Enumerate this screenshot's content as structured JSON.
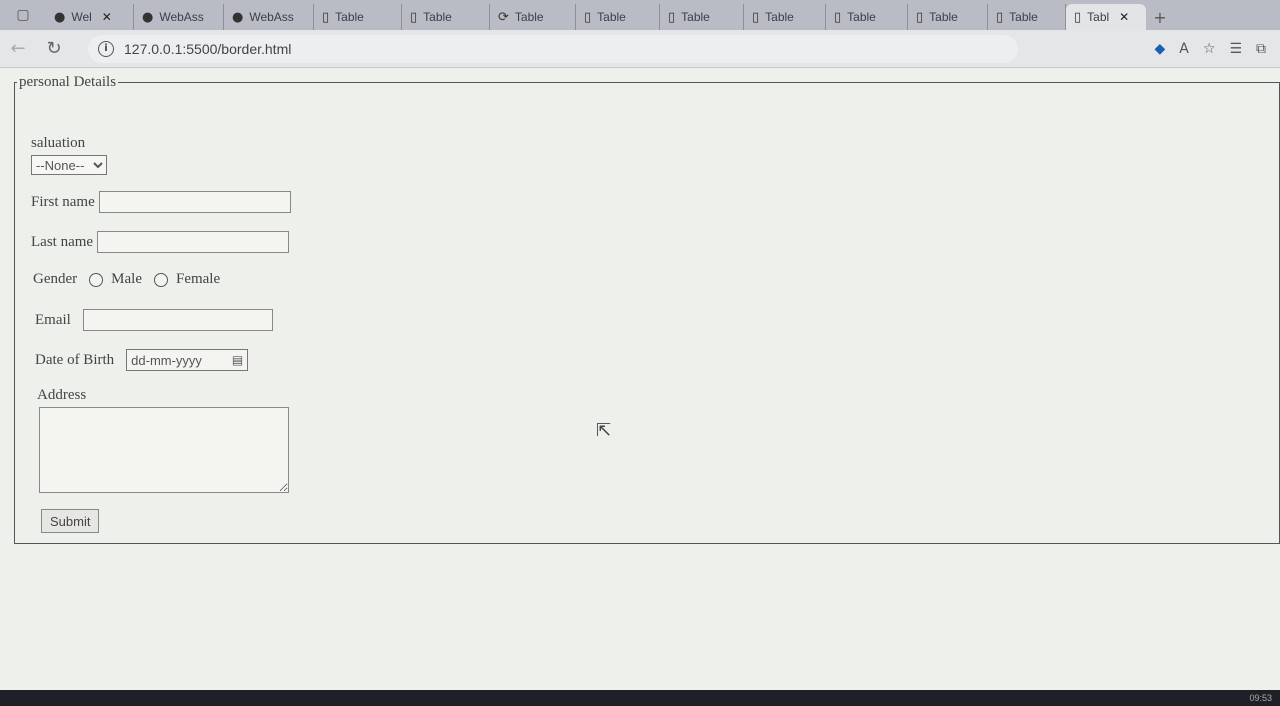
{
  "browser": {
    "tabs": [
      {
        "label": "Wel",
        "icon": "github-icon",
        "closable": true
      },
      {
        "label": "WebAss",
        "icon": "github-icon"
      },
      {
        "label": "WebAss",
        "icon": "github-icon"
      },
      {
        "label": "Table",
        "icon": "page-icon"
      },
      {
        "label": "Table",
        "icon": "page-icon"
      },
      {
        "label": "Table",
        "icon": "loading-icon"
      },
      {
        "label": "Table",
        "icon": "page-icon"
      },
      {
        "label": "Table",
        "icon": "page-icon"
      },
      {
        "label": "Table",
        "icon": "page-icon"
      },
      {
        "label": "Table",
        "icon": "page-icon"
      },
      {
        "label": "Table",
        "icon": "page-icon"
      },
      {
        "label": "Table",
        "icon": "page-icon"
      },
      {
        "label": "Tabl",
        "icon": "page-icon",
        "active": true,
        "closable": true
      }
    ],
    "url": "127.0.0.1:5500/border.html"
  },
  "form": {
    "legend": "personal Details",
    "salutation_label": "saluation",
    "salutation_value": "--None--",
    "first_name_label": "First name",
    "last_name_label": "Last name",
    "gender_label": "Gender",
    "gender_options": [
      "Male",
      "Female"
    ],
    "email_label": "Email",
    "dob_label": "Date of Birth",
    "dob_placeholder": "dd-mm-yyyy",
    "address_label": "Address",
    "submit_label": "Submit"
  },
  "taskbar": {
    "clock": "09:53"
  },
  "colors": {
    "tabstrip": "#b9bcc4",
    "page_bg": "#eef0eb",
    "accent": "#1a5fb4"
  }
}
